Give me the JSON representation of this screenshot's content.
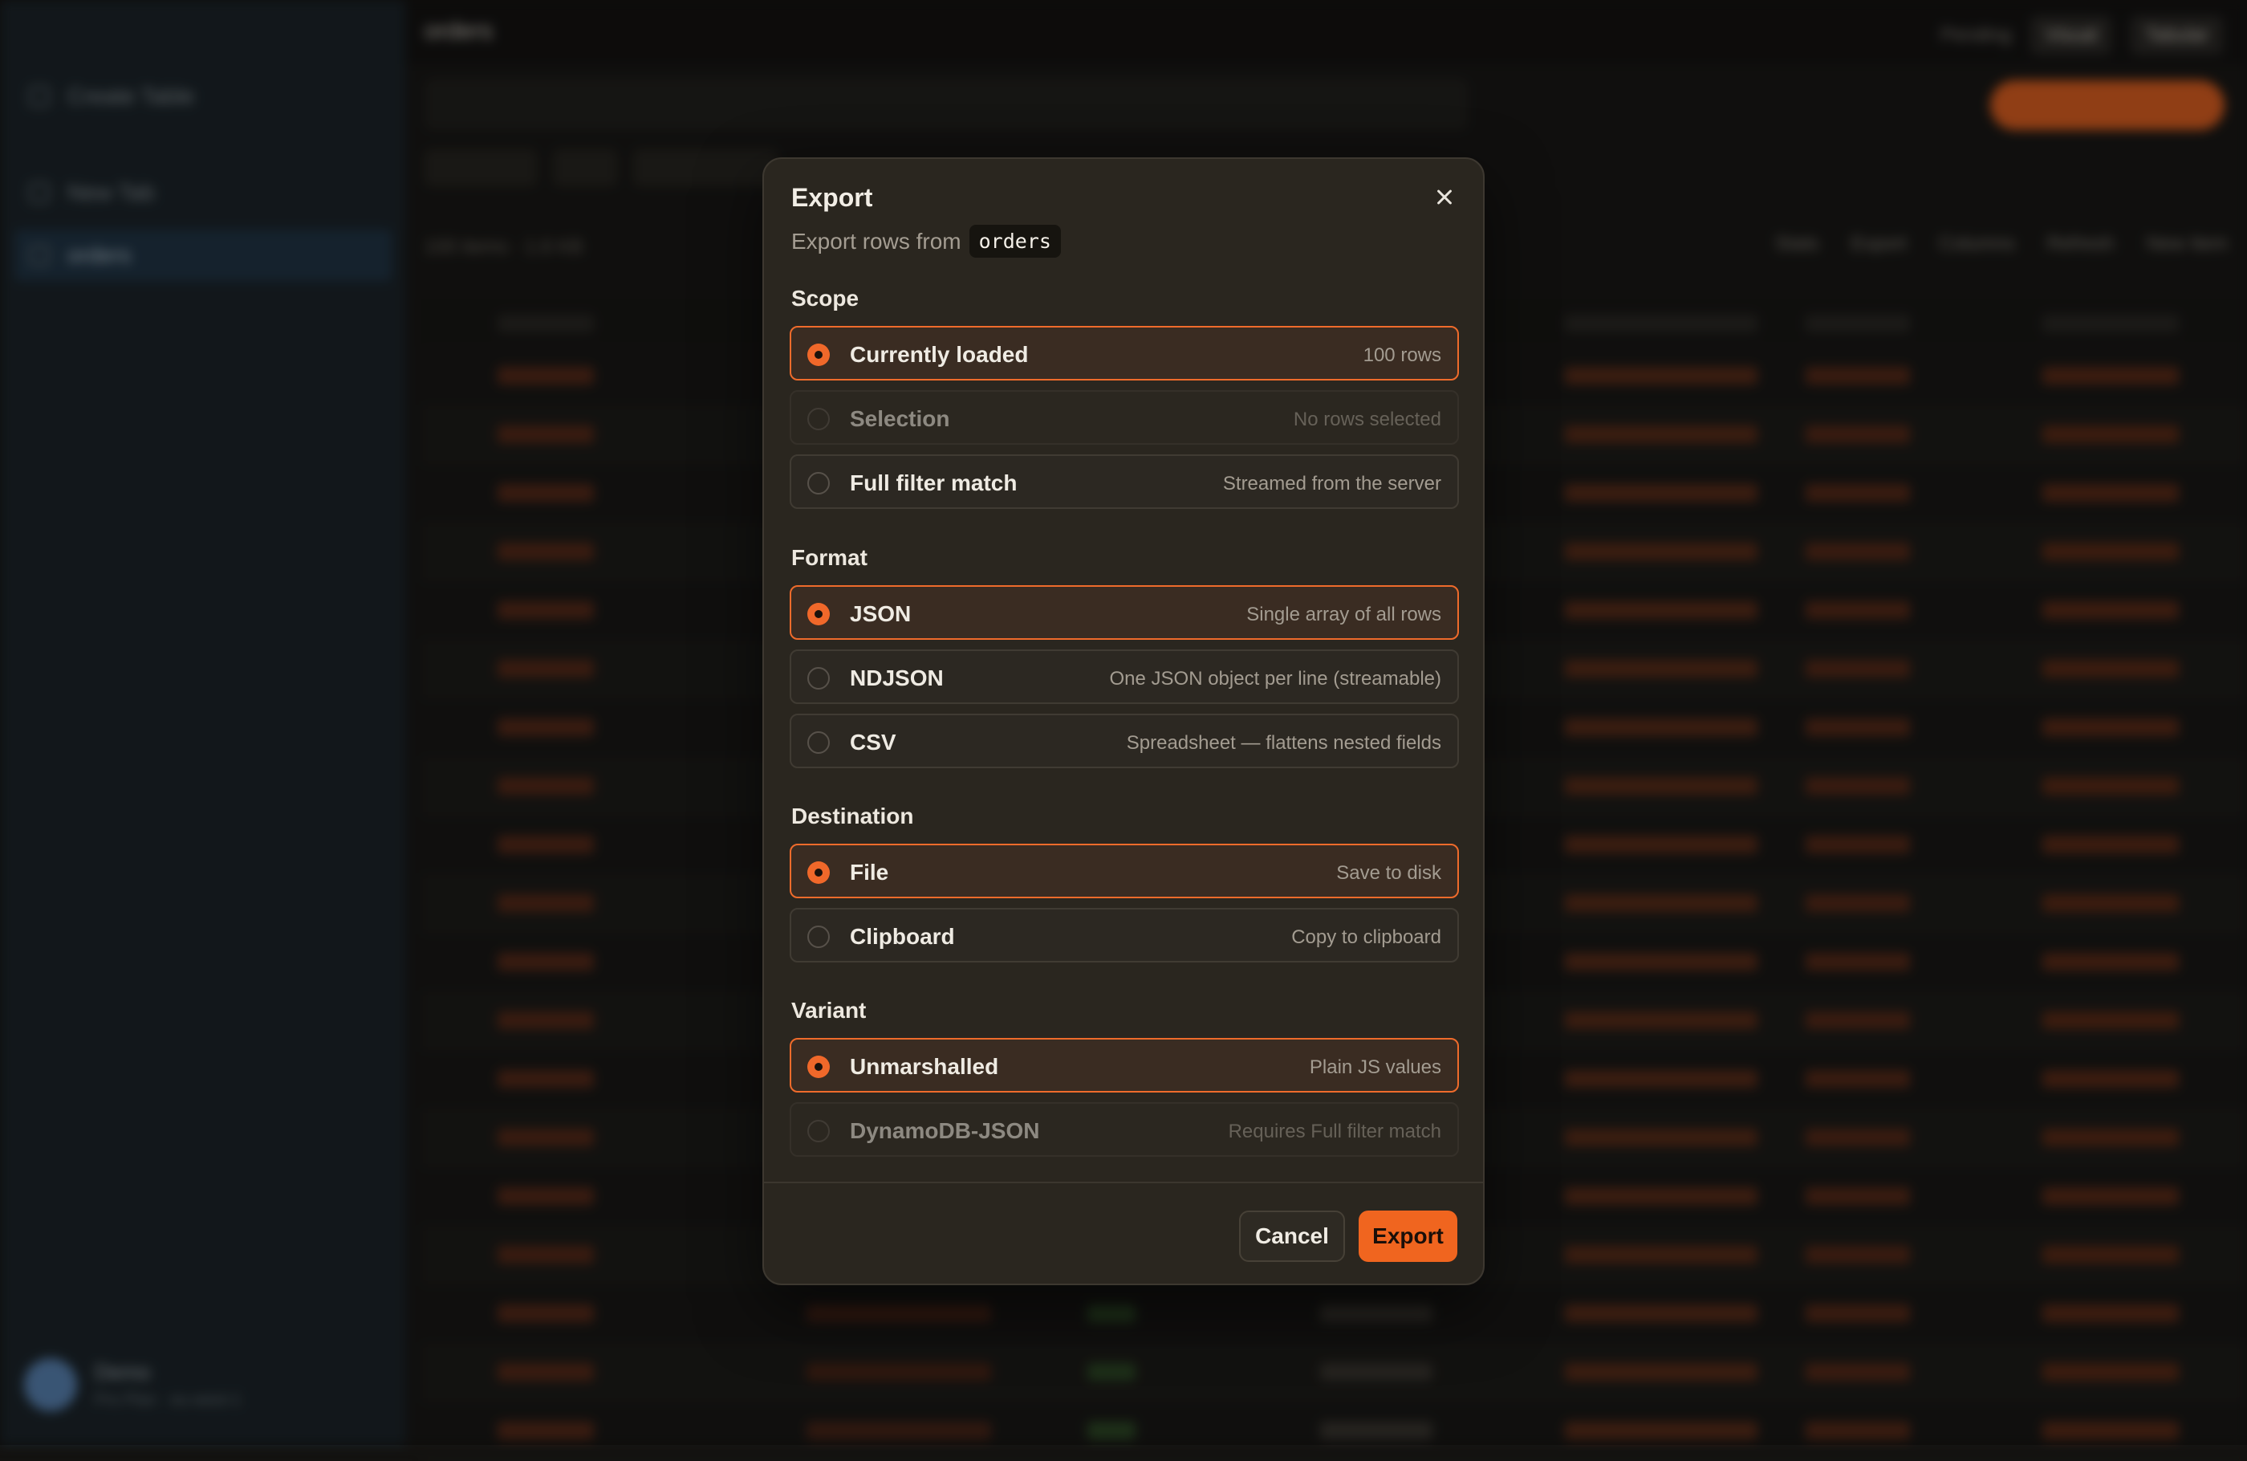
{
  "background": {
    "sidebar": {
      "items": [
        "Create Table",
        "New Tab",
        "orders"
      ],
      "user_name": "Demo",
      "user_sub": "Pro Plan · eu-west-1"
    },
    "topbar": {
      "title": "orders",
      "status": "Pending",
      "view_a": "Visual",
      "view_b": "Tabular"
    },
    "toolbar": {
      "count": "100 items · 1.6 KB",
      "actions": [
        "Stats",
        "Export",
        "Columns",
        "Refresh",
        "New Item"
      ]
    }
  },
  "modal": {
    "title": "Export",
    "subtitle_prefix": "Export rows from",
    "table_name": "orders",
    "sections": {
      "scope": {
        "label": "Scope",
        "options": [
          {
            "label": "Currently loaded",
            "desc": "100 rows",
            "selected": true,
            "disabled": false
          },
          {
            "label": "Selection",
            "desc": "No rows selected",
            "selected": false,
            "disabled": true
          },
          {
            "label": "Full filter match",
            "desc": "Streamed from the server",
            "selected": false,
            "disabled": false
          }
        ]
      },
      "format": {
        "label": "Format",
        "options": [
          {
            "label": "JSON",
            "desc": "Single array of all rows",
            "selected": true,
            "disabled": false
          },
          {
            "label": "NDJSON",
            "desc": "One JSON object per line (streamable)",
            "selected": false,
            "disabled": false
          },
          {
            "label": "CSV",
            "desc": "Spreadsheet — flattens nested fields",
            "selected": false,
            "disabled": false
          }
        ]
      },
      "destination": {
        "label": "Destination",
        "options": [
          {
            "label": "File",
            "desc": "Save to disk",
            "selected": true,
            "disabled": false
          },
          {
            "label": "Clipboard",
            "desc": "Copy to clipboard",
            "selected": false,
            "disabled": false
          }
        ]
      },
      "variant": {
        "label": "Variant",
        "options": [
          {
            "label": "Unmarshalled",
            "desc": "Plain JS values",
            "selected": true,
            "disabled": false
          },
          {
            "label": "DynamoDB-JSON",
            "desc": "Requires Full filter match",
            "selected": false,
            "disabled": true
          }
        ]
      }
    },
    "cancel_label": "Cancel",
    "export_label": "Export"
  },
  "colors": {
    "accent": "#f0651f",
    "modal_bg": "#2a261f",
    "selected_border": "#ef6b2b"
  }
}
